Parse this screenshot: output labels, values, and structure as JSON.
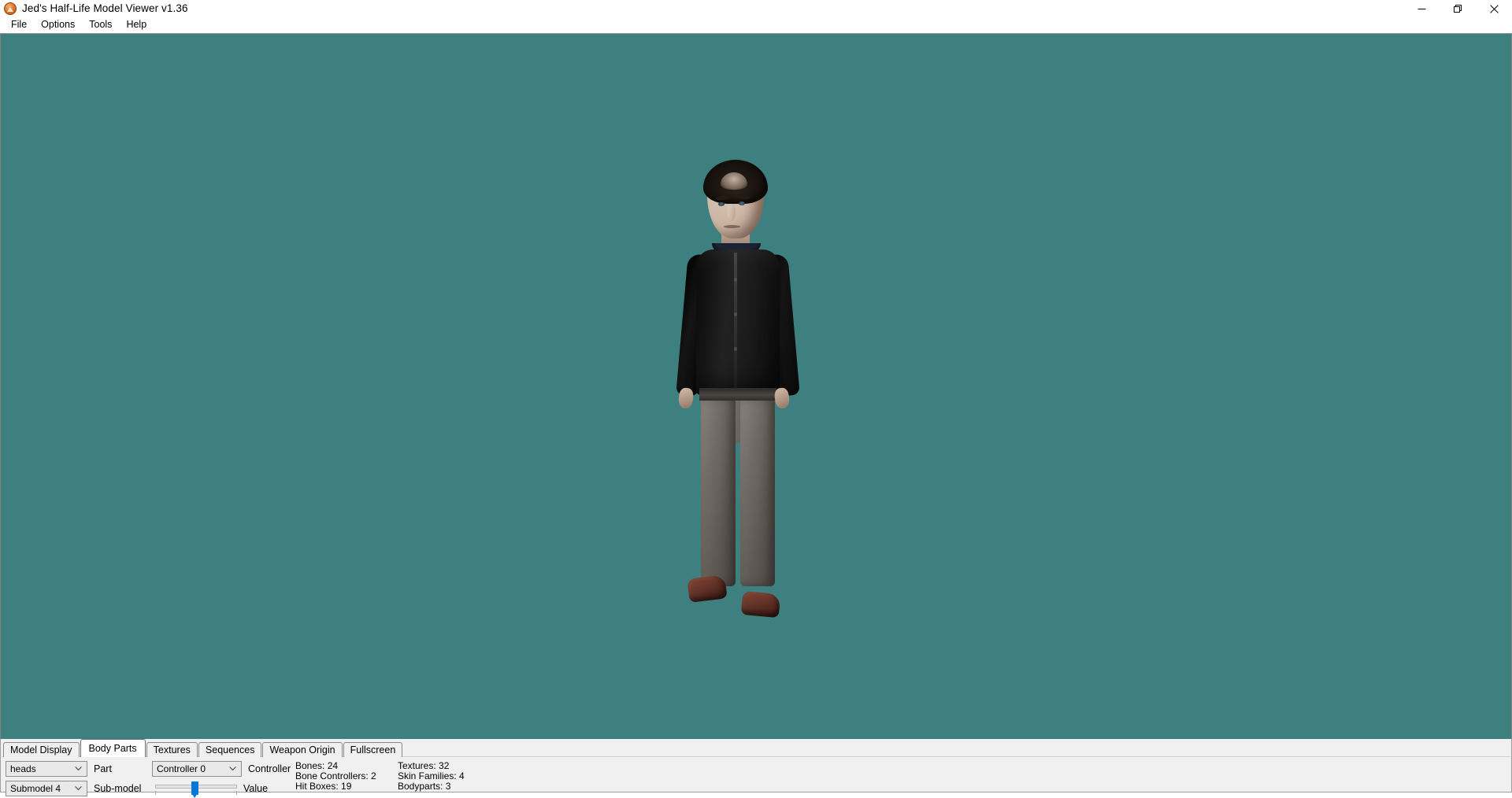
{
  "window": {
    "title": "Jed's Half-Life Model Viewer v1.36",
    "icon": "app-logo-icon",
    "controls": {
      "minimize": "minimize-icon",
      "maximize": "restore-icon",
      "close": "close-icon"
    }
  },
  "menu": {
    "items": [
      {
        "label": "File"
      },
      {
        "label": "Options"
      },
      {
        "label": "Tools"
      },
      {
        "label": "Help"
      }
    ]
  },
  "viewport": {
    "background_color": "#3e7f7f",
    "model_description": "Half-Life character model: male with dark hair, black buttoned jacket, gray trousers, brown shoes"
  },
  "tabs": [
    {
      "label": "Model Display",
      "active": false
    },
    {
      "label": "Body Parts",
      "active": true
    },
    {
      "label": "Textures",
      "active": false
    },
    {
      "label": "Sequences",
      "active": false
    },
    {
      "label": "Weapon Origin",
      "active": false
    },
    {
      "label": "Fullscreen",
      "active": false
    }
  ],
  "body_parts_panel": {
    "part": {
      "value": "heads",
      "label": "Part",
      "options": [
        "heads"
      ]
    },
    "submodel": {
      "value": "Submodel 4",
      "label": "Sub-model",
      "options": [
        "Submodel 4"
      ]
    },
    "controller": {
      "value": "Controller 0",
      "label": "Controller",
      "options": [
        "Controller 0"
      ]
    },
    "value_slider": {
      "label": "Value",
      "percent": 48
    }
  },
  "stats": {
    "column1": [
      "Bones: 24",
      "Bone Controllers: 2",
      "Hit Boxes: 19"
    ],
    "column2": [
      "Textures: 32",
      "Skin Families: 4",
      "Bodyparts: 3"
    ]
  }
}
